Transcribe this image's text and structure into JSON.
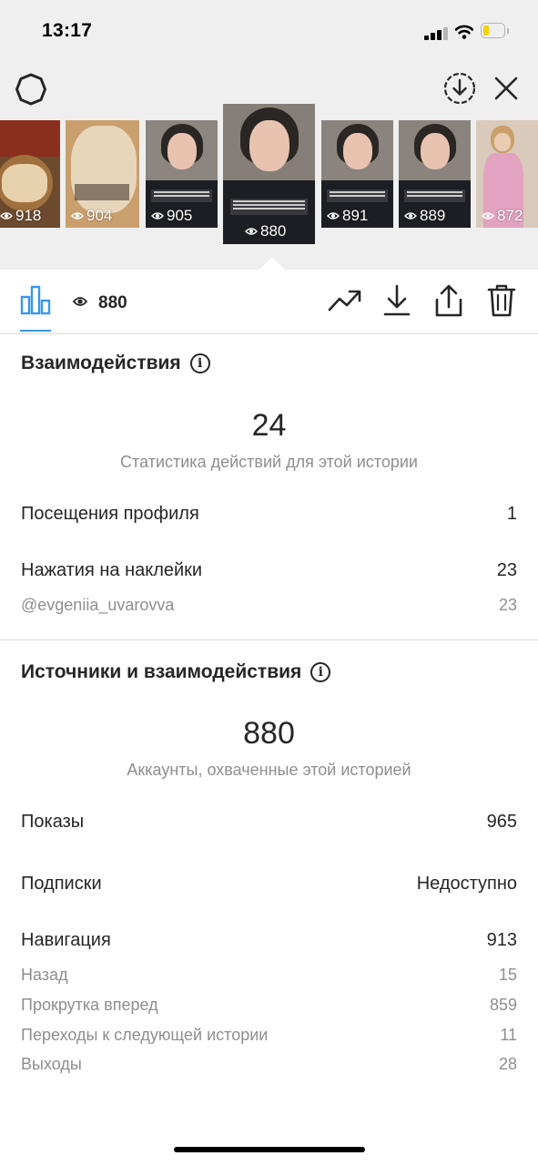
{
  "status_bar": {
    "time": "13:17",
    "battery_fraction": 0.3
  },
  "top_bar": {
    "left_icon": "ring-settings-icon",
    "right_icons": [
      "download-circle-icon",
      "close-icon"
    ]
  },
  "thumbnails": [
    {
      "views": "918",
      "theme": "bread"
    },
    {
      "views": "904",
      "theme": "bread"
    },
    {
      "views": "905",
      "theme": "person"
    },
    {
      "views": "880",
      "theme": "person",
      "active": true
    },
    {
      "views": "891",
      "theme": "person"
    },
    {
      "views": "889",
      "theme": "person"
    },
    {
      "views": "872",
      "theme": "pink"
    }
  ],
  "toolbar": {
    "views_count": "880",
    "icons": [
      "bar-chart-icon",
      "eye-icon",
      "trending-icon",
      "download-icon",
      "share-icon",
      "trash-icon"
    ]
  },
  "interactions": {
    "title": "Взаимодействия",
    "total": "24",
    "subtitle": "Статистика действий для этой истории",
    "rows": [
      {
        "label": "Посещения профиля",
        "value": "1"
      },
      {
        "label": "Нажатия на наклейки",
        "value": "23"
      },
      {
        "label": "@evgeniia_uvarovva",
        "value": "23"
      }
    ]
  },
  "discovery": {
    "title": "Источники и взаимодействия",
    "total": "880",
    "subtitle": "Аккаунты, охваченные этой историей",
    "rows": [
      {
        "label": "Показы",
        "value": "965"
      },
      {
        "label": "Подписки",
        "value": "Недоступно"
      },
      {
        "label": "Навигация",
        "value": "913"
      },
      {
        "label": "Назад",
        "value": "15"
      },
      {
        "label": "Прокрутка вперед",
        "value": "859"
      },
      {
        "label": "Переходы к следующей истории",
        "value": "11"
      },
      {
        "label": "Выходы",
        "value": "28"
      }
    ]
  },
  "colors": {
    "accent": "#3897f0",
    "battery": "#f5d100",
    "muted": "#8e8e8e",
    "text": "#262626"
  }
}
